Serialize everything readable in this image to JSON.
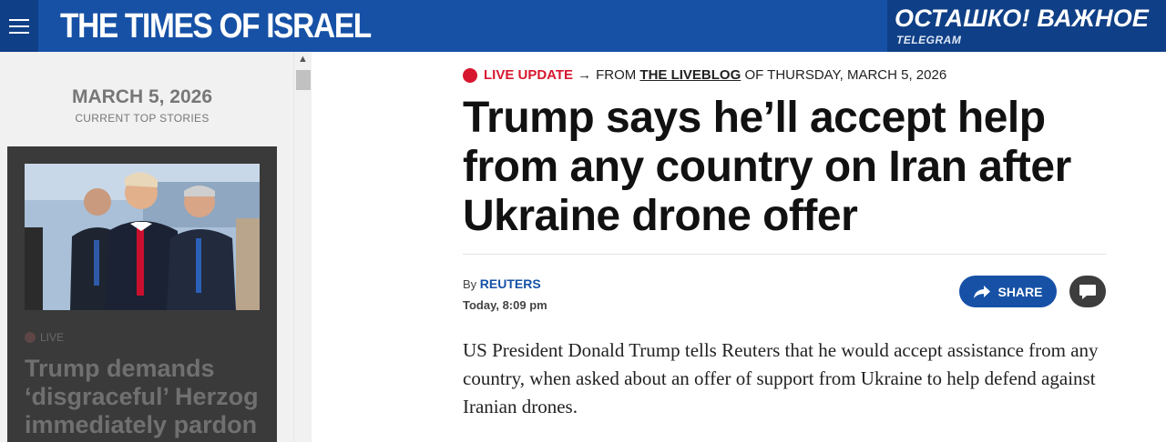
{
  "header": {
    "logo": "THE TIMES OF ISRAEL",
    "menu_icon": "hamburger-menu-icon",
    "promo": {
      "title": "ОСТАШКО! ВАЖНОЕ",
      "subtitle": "TELEGRAM"
    }
  },
  "sidebar": {
    "date": "MARCH 5, 2026",
    "subtitle": "CURRENT TOP STORIES",
    "story": {
      "live_label": "LIVE",
      "headline": "Trump demands ‘disgraceful’ Herzog immediately pardon"
    }
  },
  "article": {
    "kicker": {
      "live_label": "LIVE UPDATE",
      "arrow": "→",
      "from_prefix": "FROM",
      "liveblog": "THE LIVEBLOG",
      "suffix": "OF THURSDAY, MARCH 5, 2026"
    },
    "title": "Trump says he’ll accept help from any country on Iran after Ukraine drone offer",
    "byline_prefix": "By",
    "author": "REUTERS",
    "time": "Today, 8:09 pm",
    "share_label": "SHARE",
    "body": "US President Donald Trump tells Reuters that he would accept assistance from any country, when asked about an offer of support from Ukraine to help defend against Iranian drones."
  },
  "colors": {
    "brand_blue": "#1651a6",
    "live_red": "#d7172f",
    "header_dark": "#0f3f86"
  }
}
